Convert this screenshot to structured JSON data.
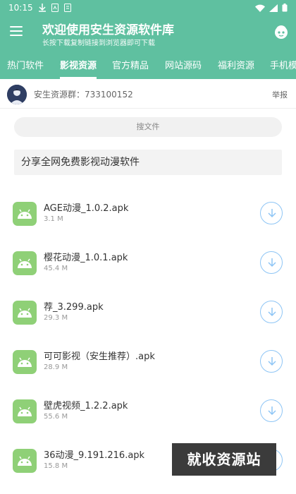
{
  "status": {
    "time": "10:15"
  },
  "header": {
    "title": "欢迎使用安生资源软件库",
    "subtitle": "长按下载复制链接到浏览器即可下载",
    "accent": "#5fc0a0"
  },
  "tabs": [
    {
      "label": "热门软件",
      "active": false
    },
    {
      "label": "影视资源",
      "active": true
    },
    {
      "label": "官方精品",
      "active": false
    },
    {
      "label": "网站源码",
      "active": false
    },
    {
      "label": "福利资源",
      "active": false
    },
    {
      "label": "手机模",
      "active": false
    }
  ],
  "group": {
    "label": "安生资源群：733100152",
    "report": "举报"
  },
  "search": {
    "placeholder": "搜文件"
  },
  "announcement": "分享全网免费影视动漫软件",
  "files": [
    {
      "name": "AGE动漫_1.0.2.apk",
      "size": "3.1 M"
    },
    {
      "name": "樱花动漫_1.0.1.apk",
      "size": "45.4 M"
    },
    {
      "name": "荐_3.299.apk",
      "size": "29.3 M"
    },
    {
      "name": "可可影视（安生推荐）.apk",
      "size": "28.9 M"
    },
    {
      "name": "壁虎视频_1.2.2.apk",
      "size": "55.6 M"
    },
    {
      "name": "36动漫_9.191.216.apk",
      "size": "15.8 M"
    }
  ],
  "watermark": "就收资源站",
  "icons": {
    "menu": "hamburger-icon",
    "face": "face-icon",
    "file": "android-icon",
    "download": "download-icon"
  }
}
